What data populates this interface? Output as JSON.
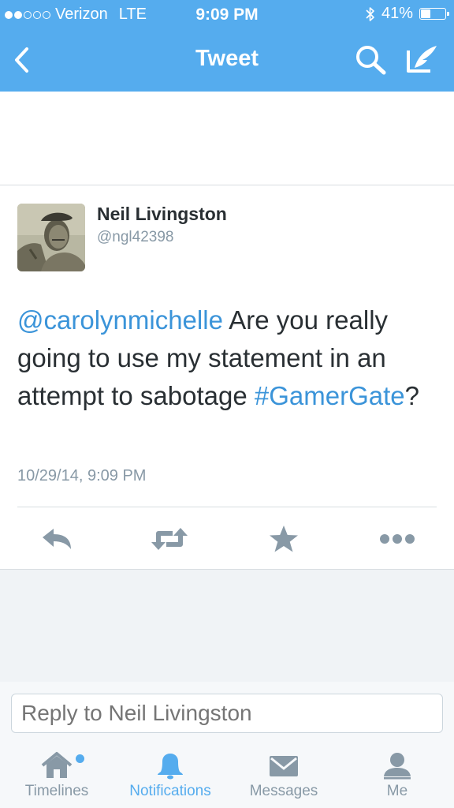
{
  "status_bar": {
    "carrier": "Verizon",
    "network": "LTE",
    "time": "9:09 PM",
    "battery": "41%",
    "battery_level": 0.41,
    "signal_bars_filled": 2,
    "signal_bars_total": 5
  },
  "nav": {
    "title": "Tweet",
    "back_icon": "chevron-left-icon",
    "search_icon": "search-icon",
    "compose_icon": "compose-icon"
  },
  "tweet": {
    "author_name": "Neil Livingston",
    "author_handle": "@ngl42398",
    "text_mention": "@carolynmichelle",
    "text_body": " Are you really going to use my statement in an attempt to sabotage ",
    "text_hashtag": "#GamerGate",
    "text_end": "?",
    "timestamp": "10/29/14, 9:09 PM"
  },
  "actions": [
    "reply-icon",
    "retweet-icon",
    "favorite-star-icon",
    "more-icon"
  ],
  "reply": {
    "placeholder": "Reply to Neil Livingston"
  },
  "tabs": [
    {
      "label": "Timelines",
      "icon": "home-icon"
    },
    {
      "label": "Notifications",
      "icon": "bell-icon"
    },
    {
      "label": "Messages",
      "icon": "envelope-icon"
    },
    {
      "label": "Me",
      "icon": "person-icon"
    }
  ],
  "colors": {
    "brand": "#55acee",
    "link": "#3b94d9",
    "icon_grey": "#8899a6"
  }
}
